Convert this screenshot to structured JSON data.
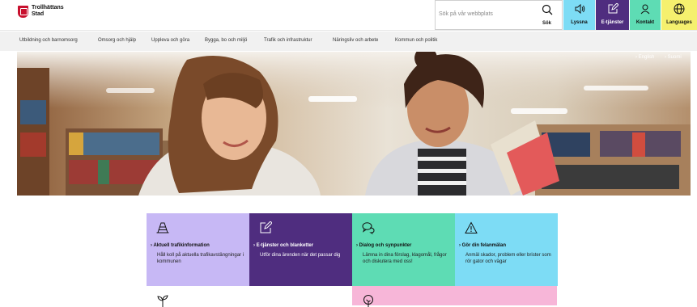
{
  "logo": {
    "line1": "Trollhättans",
    "line2": "Stad"
  },
  "search": {
    "placeholder": "Sök på vår webbplats",
    "button_label": "Sök"
  },
  "toolbar": {
    "listen": "Lyssna",
    "eservices": "E-tjänster",
    "contact": "Kontakt",
    "languages": "Languages"
  },
  "nav": [
    "Utbildning och barnomsorg",
    "Omsorg och hjälp",
    "Uppleva och göra",
    "Bygga, bo och miljö",
    "Trafik och infrastruktur",
    "Näringsliv och arbete",
    "Kommun och politik"
  ],
  "language_links": [
    "English",
    "Suomi"
  ],
  "cards": [
    {
      "title": "Aktuell trafikinformation",
      "desc": "Håll koll på aktuella trafikavstängningar i kommunen",
      "icon": "traffic-cone-icon",
      "color": "#c7b8f5"
    },
    {
      "title": "E-tjänster och blanketter",
      "desc": "Utför dina ärenden när det passar dig",
      "icon": "edit-icon",
      "color": "#4f2d7f"
    },
    {
      "title": "Dialog och synpunkter",
      "desc": "Lämna in dina förslag, klagomål, frågor och diskutera med oss!",
      "icon": "chat-bubbles-icon",
      "color": "#5edcb4"
    },
    {
      "title": "Gör din felanmälan",
      "desc": "Anmäl skador, problem eller brister som rör gator och vägar",
      "icon": "warning-icon",
      "color": "#7ddcf5"
    }
  ],
  "colors": {
    "listen_bg": "#7ddcf5",
    "eservices_bg": "#4f2d7f",
    "contact_bg": "#5edcb4",
    "languages_bg": "#f5f06e",
    "card_row2_left": "#ffffff",
    "card_row2_right": "#f7b6d8"
  }
}
